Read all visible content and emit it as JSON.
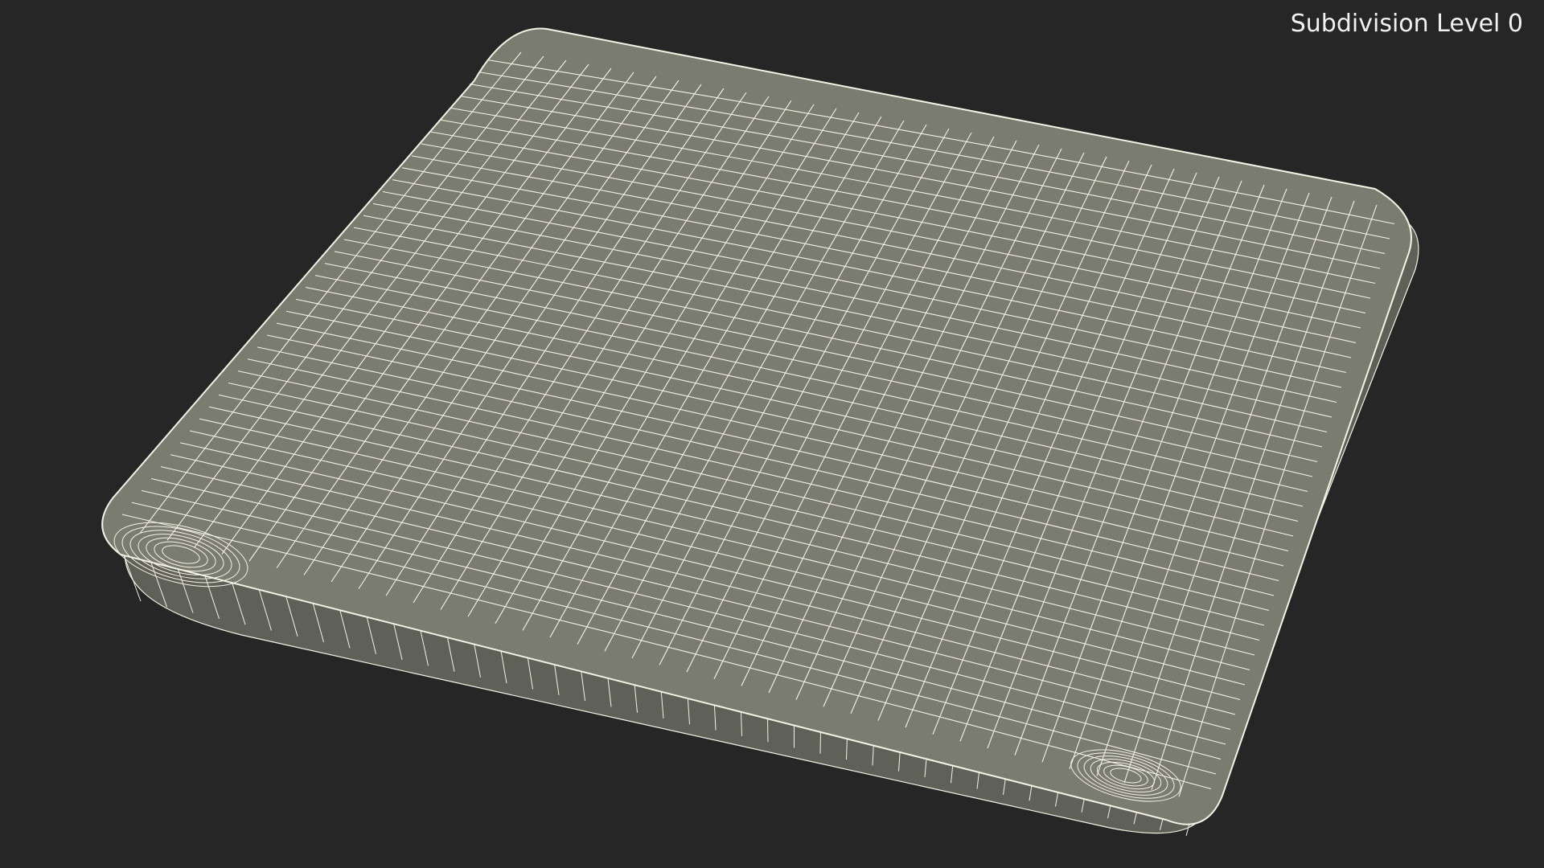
{
  "viewport": {
    "subdivision_label": "Subdivision Level 0",
    "background_color": "#262626"
  },
  "model": {
    "subject": "rounded cushion pad wireframe",
    "surface_color": "#7b7c70",
    "shadow_color": "#5f6057",
    "wire_color": "#f4f2e4"
  }
}
